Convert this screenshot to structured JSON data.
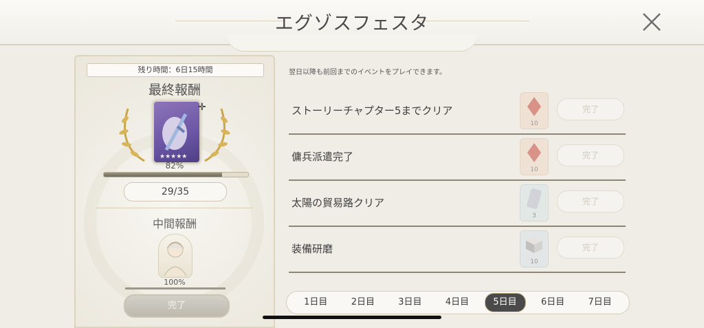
{
  "header": {
    "title": "エグゾスフェスタ"
  },
  "reward_panel": {
    "remaining_time": "残り時間：6日15時間",
    "final_title": "最終報酬",
    "final_progress_pct": "82%",
    "final_progress_value": 0.82,
    "count": "29/35",
    "mid_title": "中間報酬",
    "mid_progress_pct": "100%",
    "mid_progress_value": 1.0,
    "complete_label": "完了"
  },
  "missions": {
    "notice": "翌日以降も前回までのイベントをプレイできます。",
    "items": [
      {
        "label": "ストーリーチャプター5までクリア",
        "qty": "10",
        "claim": "完了"
      },
      {
        "label": "傭兵派遣完了",
        "qty": "10",
        "claim": "完了"
      },
      {
        "label": "太陽の貿易路クリア",
        "qty": "3",
        "claim": "完了"
      },
      {
        "label": "装備研磨",
        "qty": "10",
        "claim": "完了"
      }
    ]
  },
  "day_tabs": {
    "items": [
      "1日目",
      "2日目",
      "3日目",
      "4日目",
      "5日目",
      "6日目",
      "7日目"
    ],
    "active_index": 4
  }
}
